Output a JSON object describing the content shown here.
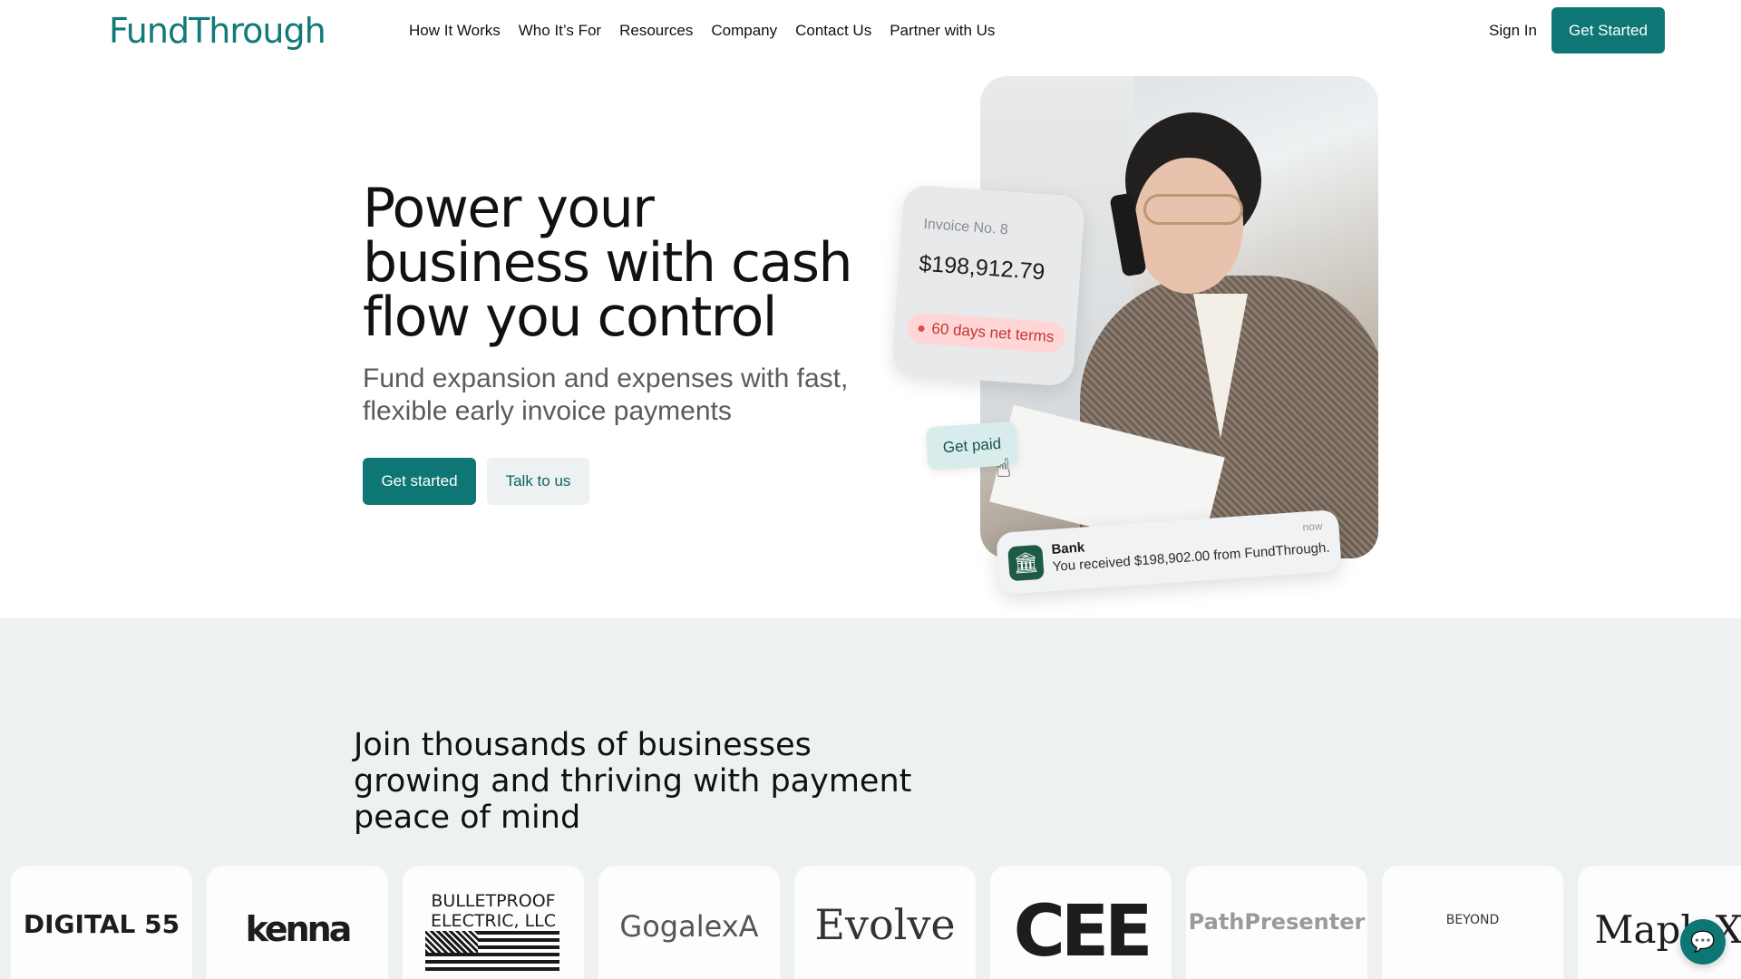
{
  "brand": {
    "logo_text": "FundThrough",
    "accent": "#0e7674"
  },
  "nav": {
    "items": [
      "How It Works",
      "Who It’s For",
      "Resources",
      "Company",
      "Contact Us",
      "Partner with Us"
    ],
    "sign_in": "Sign In",
    "cta": "Get Started"
  },
  "hero": {
    "title": "Power your business with cash flow you control",
    "subtitle": "Fund expansion and expenses with fast, flexible early invoice payments",
    "primary_button": "Get started",
    "secondary_button": "Talk to us"
  },
  "invoice_card": {
    "label": "Invoice No. 8",
    "amount": "$198,912.79",
    "terms": "60 days net terms"
  },
  "get_paid_button": "Get paid",
  "bank_notification": {
    "title": "Bank",
    "message": "You received $198,902.00 from FundThrough.",
    "time": "now",
    "icon": "bank-icon"
  },
  "trust": {
    "title": "Join thousands of businesses growing and thriving with payment peace of mind",
    "logos": [
      "DIGITAL 55",
      "kenna",
      "BULLETPROOF ELECTRIC, LLC",
      "GogalexA",
      "Evolve",
      "CEE",
      "PathPresenter",
      "BEYOND",
      "MapleX"
    ]
  },
  "chat_button": {
    "icon": "chat-icon"
  }
}
